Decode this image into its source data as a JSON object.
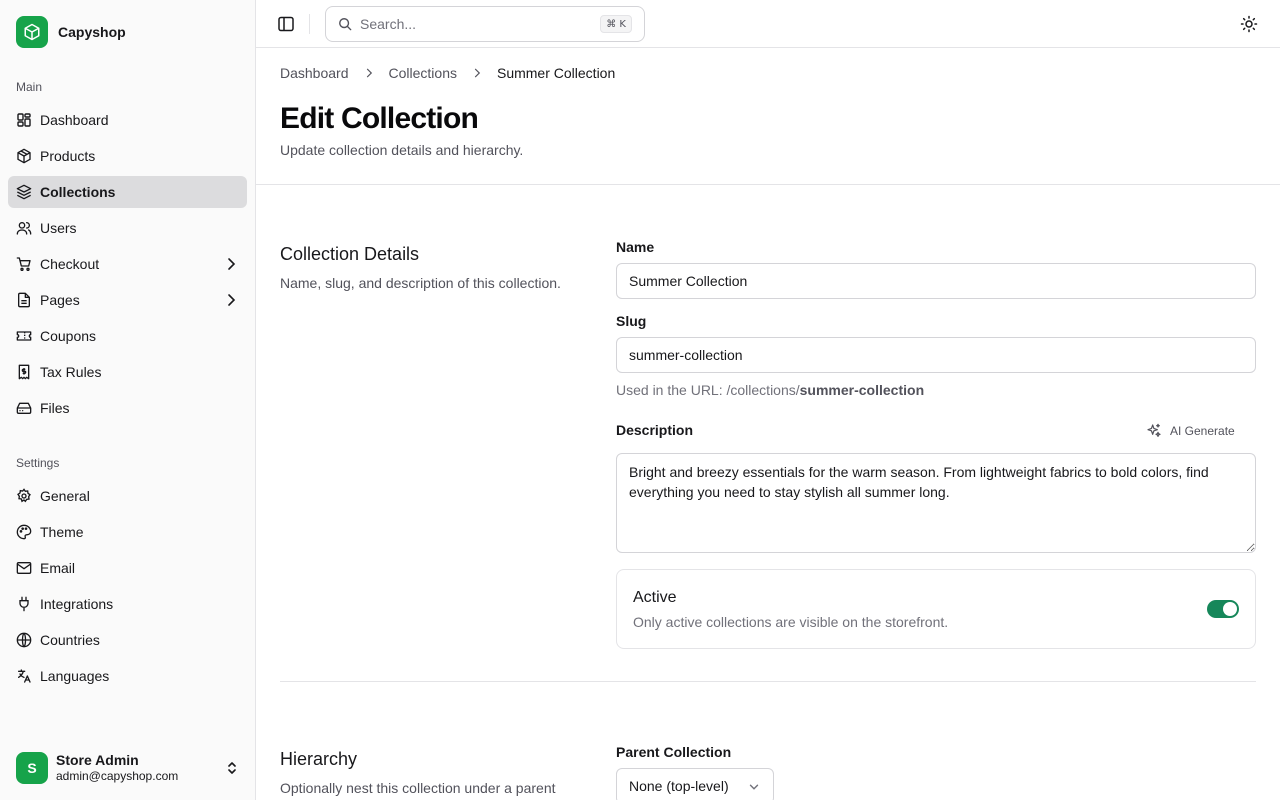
{
  "brand": {
    "name": "Capyshop",
    "icon": "box-icon",
    "accent": "#16a34a"
  },
  "sidebar": {
    "main_label": "Main",
    "main_items": [
      {
        "label": "Dashboard",
        "icon": "dashboard-icon"
      },
      {
        "label": "Products",
        "icon": "package-icon"
      },
      {
        "label": "Collections",
        "icon": "layers-icon",
        "active": true
      },
      {
        "label": "Users",
        "icon": "users-icon"
      },
      {
        "label": "Checkout",
        "icon": "cart-icon",
        "has_children": true
      },
      {
        "label": "Pages",
        "icon": "file-icon",
        "has_children": true
      },
      {
        "label": "Coupons",
        "icon": "ticket-icon"
      },
      {
        "label": "Tax Rules",
        "icon": "receipt-icon"
      },
      {
        "label": "Files",
        "icon": "drive-icon"
      }
    ],
    "settings_label": "Settings",
    "settings_items": [
      {
        "label": "General",
        "icon": "gear-icon"
      },
      {
        "label": "Theme",
        "icon": "palette-icon"
      },
      {
        "label": "Email",
        "icon": "mail-icon"
      },
      {
        "label": "Integrations",
        "icon": "plug-icon"
      },
      {
        "label": "Countries",
        "icon": "globe-icon"
      },
      {
        "label": "Languages",
        "icon": "languages-icon"
      }
    ],
    "user": {
      "initial": "S",
      "name": "Store Admin",
      "email": "admin@capyshop.com"
    }
  },
  "topbar": {
    "search_placeholder": "Search...",
    "shortcut": "⌘ K"
  },
  "breadcrumb": {
    "items": [
      "Dashboard",
      "Collections"
    ],
    "current": "Summer Collection"
  },
  "page": {
    "title": "Edit Collection",
    "subtitle": "Update collection details and hierarchy."
  },
  "details": {
    "title": "Collection Details",
    "description": "Name, slug, and description of this collection.",
    "name_label": "Name",
    "name_value": "Summer Collection",
    "slug_label": "Slug",
    "slug_value": "summer-collection",
    "slug_hint_prefix": "Used in the URL: /collections/",
    "slug_hint_value": "summer-collection",
    "description_label": "Description",
    "ai_generate_label": "AI Generate",
    "description_value": "Bright and breezy essentials for the warm season. From lightweight fabrics to bold colors, find everything you need to stay stylish all summer long.",
    "active_title": "Active",
    "active_desc": "Only active collections are visible on the storefront.",
    "active_on": true,
    "toggle_color": "#16875a"
  },
  "hierarchy": {
    "title": "Hierarchy",
    "description": "Optionally nest this collection under a parent",
    "parent_label": "Parent Collection",
    "parent_value": "None (top-level)"
  }
}
